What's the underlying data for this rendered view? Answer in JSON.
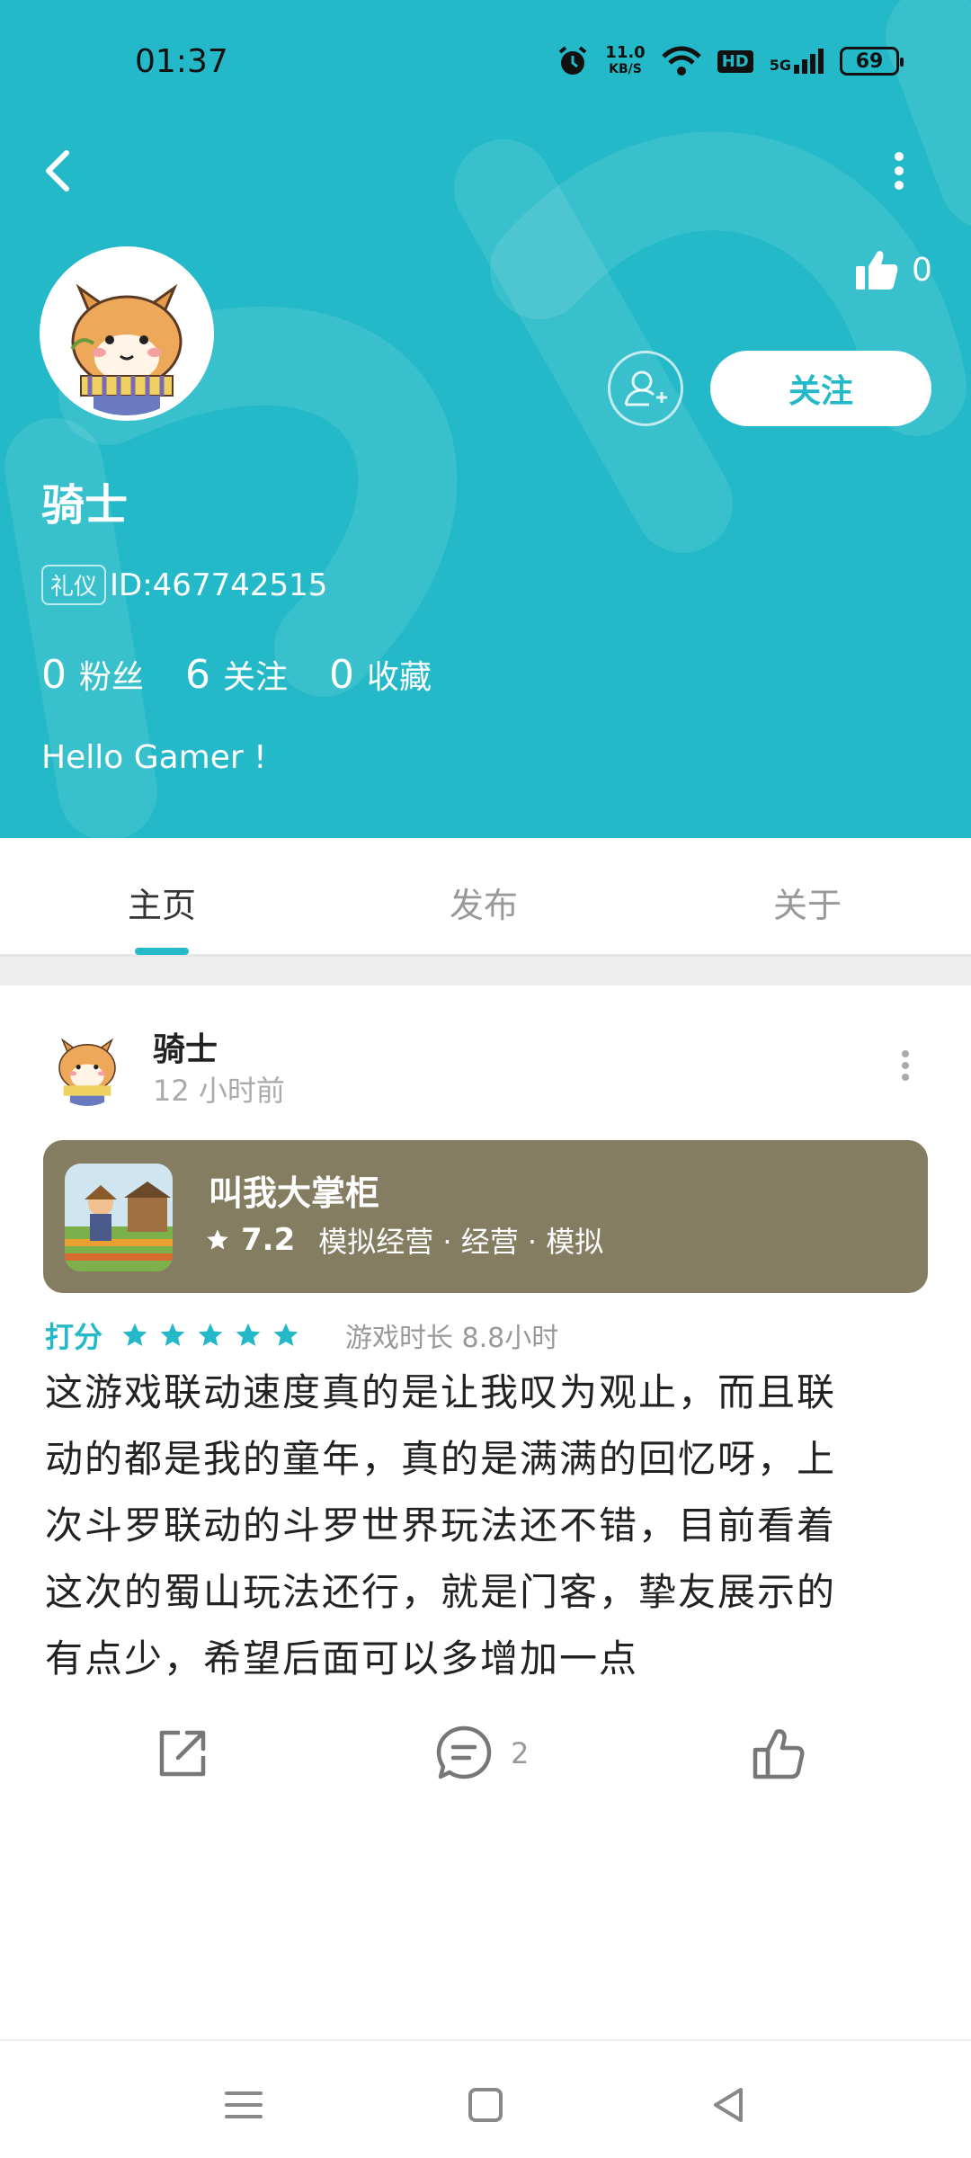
{
  "status_bar": {
    "time": "01:37",
    "net_speed_value": "11.0",
    "net_speed_unit": "KB/S",
    "hd_label": "HD",
    "signal_label": "5G",
    "battery": "69"
  },
  "profile": {
    "likes": "0",
    "follow_label": "关注",
    "username": "骑士",
    "etiquette_badge": "礼仪",
    "user_id": "ID:467742515",
    "stats": [
      {
        "num": "0",
        "label": "粉丝"
      },
      {
        "num": "6",
        "label": "关注"
      },
      {
        "num": "0",
        "label": "收藏"
      }
    ],
    "bio": "Hello Gamer !"
  },
  "tabs": [
    {
      "label": "主页",
      "active": true
    },
    {
      "label": "发布",
      "active": false
    },
    {
      "label": "关于",
      "active": false
    }
  ],
  "post": {
    "author": "骑士",
    "time": "12 小时前",
    "game": {
      "name": "叫我大掌柜",
      "rating": "7.2",
      "tags": "模拟经营 · 经营 · 模拟"
    },
    "rating_label": "打分",
    "stars": 5,
    "playtime": "游戏时长 8.8小时",
    "body_lines": [
      "这游戏联动速度真的是让我叹为观止，而且联",
      "动的都是我的童年，真的是满满的回忆呀，上",
      "次斗罗联动的斗罗世界玩法还不错，目前看着",
      "这次的蜀山玩法还行，就是门客，挚友展示的",
      "有点少，希望后面可以多增加一点"
    ],
    "comment_count": "2"
  },
  "colors": {
    "brand": "#23b9c8",
    "game_card": "#857d62"
  }
}
